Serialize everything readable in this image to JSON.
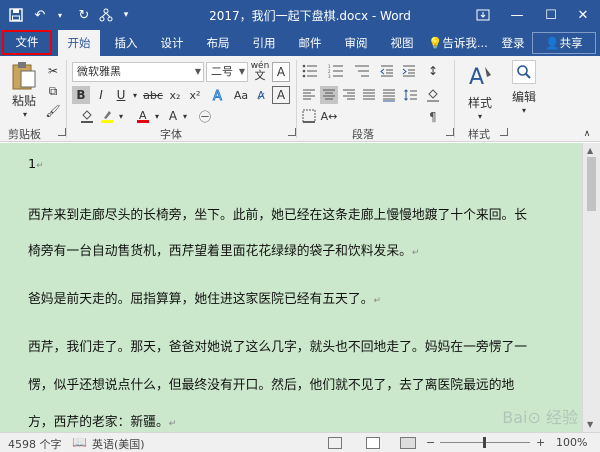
{
  "window": {
    "title": "2017，我们一起下盘棋.docx - Word"
  },
  "quick_access": {
    "save": "save-icon",
    "undo": "undo-icon",
    "redo": "redo-icon",
    "touch": "touch-mode-icon"
  },
  "tabs": [
    "文件",
    "开始",
    "插入",
    "设计",
    "布局",
    "引用",
    "邮件",
    "审阅",
    "视图"
  ],
  "tell_me": "告诉我...",
  "login": "登录",
  "share": "共享",
  "ribbon": {
    "paste": "粘贴",
    "font_name": "微软雅黑",
    "font_size": "二号",
    "wen": "wén",
    "groups": {
      "clipboard": "剪贴板",
      "font": "字体",
      "paragraph": "段落",
      "styles": "样式"
    },
    "styles_btn": "样式",
    "editing_btn": "编辑"
  },
  "document": {
    "lines": [
      "1",
      "西芹来到走廊尽头的长椅旁，坐下。此前，她已经在这条走廊上慢慢地踱了十个来回。长",
      "椅旁有一台自动售货机，西芹望着里面花花绿绿的袋子和饮料发呆。",
      "爸妈是前天走的。屈指算算，她住进这家医院已经有五天了。",
      "西芹，我们走了。那天，爸爸对她说了这么几字，就头也不回地走了。妈妈在一旁愣了一",
      "愣，似乎还想说点什么，但最终没有开口。然后，他们就不见了，去了离医院最远的地",
      "方，西芹的老家：新疆。"
    ]
  },
  "status": {
    "word_count": "4598 个字",
    "language": "英语(美国)",
    "zoom": "100%"
  },
  "colors": {
    "title_bar": "#2b579a",
    "doc_bg": "#cce8cc",
    "highlight": "#e8000b"
  }
}
